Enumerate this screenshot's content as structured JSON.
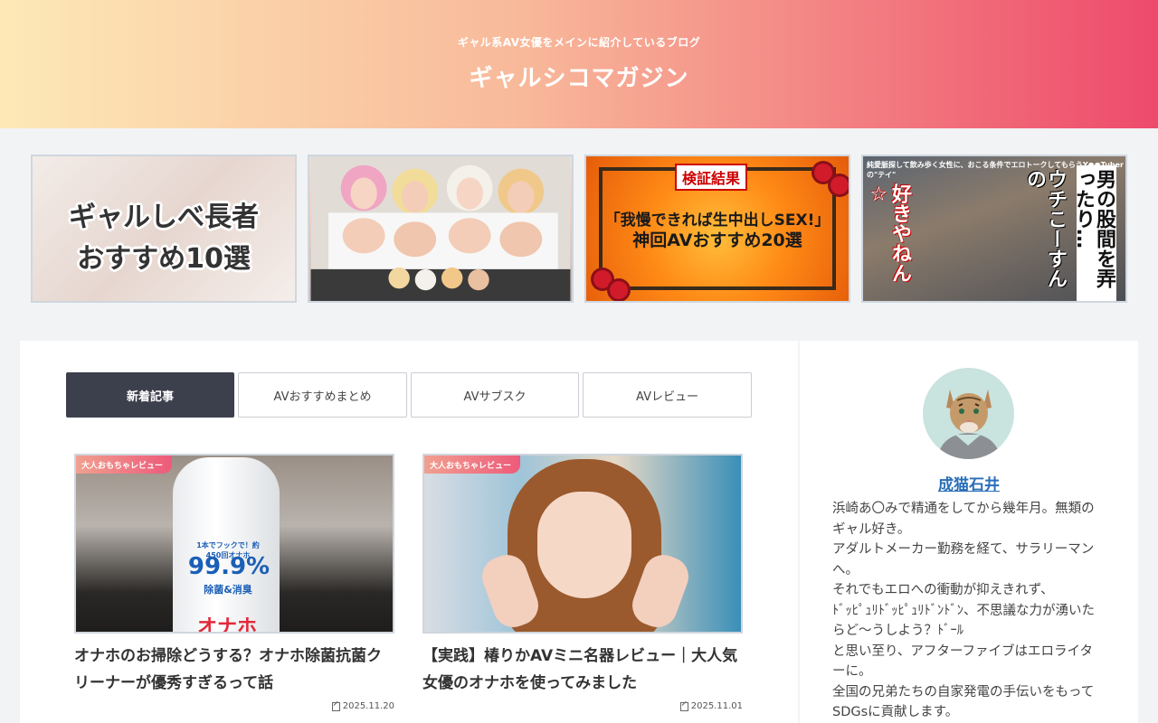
{
  "header": {
    "tagline": "ギャル系AV女優をメインに紹介しているブログ",
    "site_title": "ギャルシコマガジン"
  },
  "pickup": [
    {
      "line1": "ギャルしべ長者",
      "line2": "おすすめ10選"
    },
    {
      "caption": ""
    },
    {
      "badge": "検証結果",
      "line1": "「我慢できれば生中出しSEX!」",
      "line2": "神回AVおすすめ20選"
    },
    {
      "top": "純愛脈探して飲み歩く女性に、おこる条件でエロトークしてもらうY●●Tuberの\"テイ\"",
      "col1": "男の股間を弄ったり…",
      "col2": "ウチこーすんの",
      "col3": "好きやねん☆"
    }
  ],
  "tabs": [
    "新着記事",
    "AVおすすめまとめ",
    "AVサブスク",
    "AVレビュー"
  ],
  "articles": [
    {
      "category": "大人おもちゃレビュー",
      "title": "オナホのお掃除どうする？オナホ除菌抗菌クリーナーが優秀すぎるって話",
      "date": "2025.11.20",
      "label_a": "1本でフックで！約450回オナホ",
      "label_b": "99.9%",
      "label_c": "除菌&消臭",
      "label_d": "オナホ"
    },
    {
      "category": "大人おもちゃレビュー",
      "title": "【実践】椿りかAVミニ名器レビュー｜大人気女優のオナホを使ってみました",
      "date": "2025.11.01"
    }
  ],
  "sidebar": {
    "author_name": "成猫石井",
    "bio": [
      "浜崎あ〇みで精通をしてから幾年月。無類のギャル好き。",
      "アダルトメーカー勤務を経て、サラリーマンへ。",
      "それでもエロへの衝動が抑えきれず、",
      "ﾄﾞｯﾋﾟｭﾘﾄﾞｯﾋﾟｭﾘﾄﾞﾝﾄﾞﾝ、不思議な力が湧いたらど〜うしよう？ﾄﾞｰﾙ",
      "と思い至り、アフターファイブはエロライターに。",
      "全国の兄弟たちの自家発電の手伝いをもってSDGsに貢献します。"
    ]
  },
  "colors": {
    "header_start": "#fde9b7",
    "header_end": "#ee4a6b",
    "active_tab": "#3c3f4c",
    "author_link": "#2a6fb8"
  }
}
